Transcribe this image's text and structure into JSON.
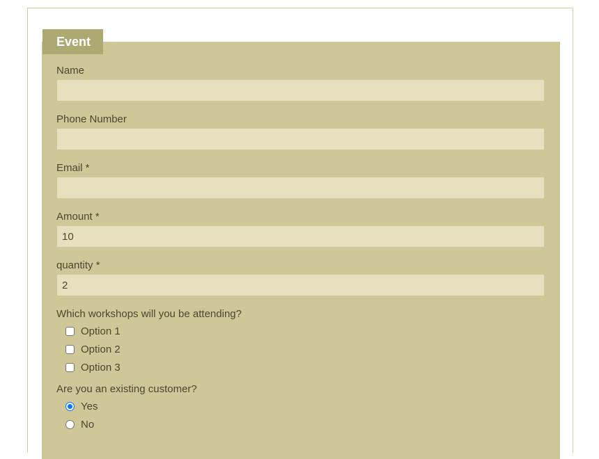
{
  "form": {
    "legend": "Event",
    "fields": [
      {
        "label": "Name",
        "value": ""
      },
      {
        "label": "Phone Number",
        "value": ""
      },
      {
        "label": "Email *",
        "value": ""
      },
      {
        "label": "Amount *",
        "value": "10"
      },
      {
        "label": "quantity *",
        "value": "2"
      }
    ],
    "workshops": {
      "label": "Which workshops will you be attending?",
      "options": [
        {
          "label": "Option 1",
          "checked": false
        },
        {
          "label": "Option 2",
          "checked": false
        },
        {
          "label": "Option 3",
          "checked": false
        }
      ]
    },
    "customer": {
      "label": "Are you an existing customer?",
      "options": [
        {
          "label": "Yes",
          "selected": true
        },
        {
          "label": "No",
          "selected": false
        }
      ]
    }
  },
  "colors": {
    "panel": "#cfc797",
    "legend": "#aca973",
    "input": "#e5e0bd",
    "text": "#4a4630",
    "accent": "#0a74ff"
  }
}
